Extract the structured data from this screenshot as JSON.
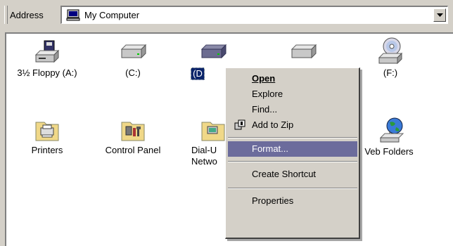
{
  "address_bar": {
    "label": "Address",
    "value": "My Computer",
    "icon": "computer-icon",
    "dropdown_icon": "chevron-down-icon"
  },
  "items": [
    {
      "label": "3½ Floppy (A:)",
      "icon": "floppy-drive-icon"
    },
    {
      "label": "(C:)",
      "icon": "hard-drive-icon"
    },
    {
      "label": "(D",
      "icon": "hard-drive-icon",
      "selected": true
    },
    {
      "label": "(F:)",
      "icon": "cd-drive-icon"
    },
    {
      "label": "Printers",
      "icon": "printer-folder-icon"
    },
    {
      "label": "Control Panel",
      "icon": "control-panel-icon"
    },
    {
      "label": "Dial-U",
      "label2": "Netwo",
      "icon": "dialup-folder-icon"
    },
    {
      "label": "Veb Folders",
      "icon": "web-folders-icon"
    }
  ],
  "context_menu": {
    "items": [
      "Open",
      "Explore",
      "Find...",
      "Add to Zip",
      "Format...",
      "Create Shortcut",
      "Properties"
    ],
    "highlighted": "Format...",
    "default": "Open"
  },
  "colors": {
    "face": "#d4d0c8",
    "highlight": "#6c6c9c",
    "selection": "#0a246a"
  }
}
